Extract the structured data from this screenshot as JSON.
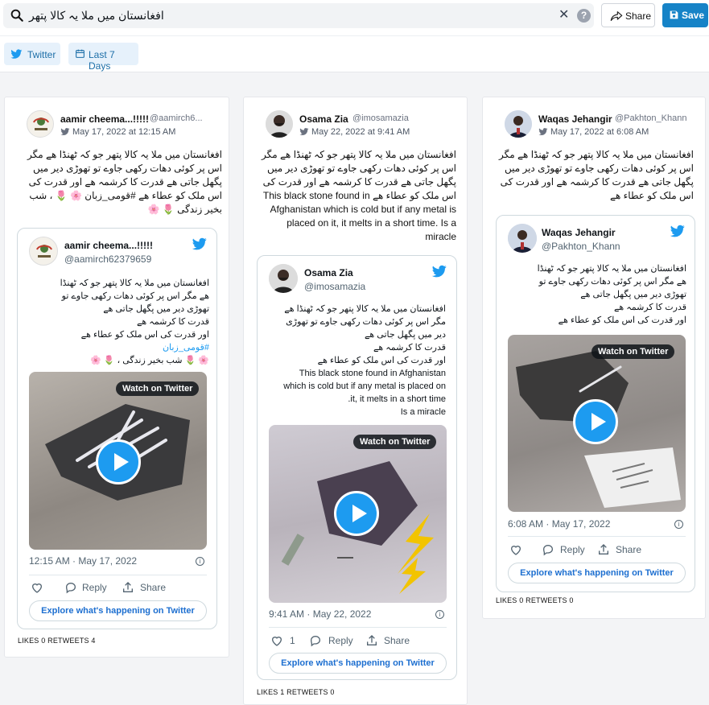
{
  "search": {
    "query": "افغانستان میں ملا یہ کالا پتھر"
  },
  "toolbar": {
    "share_label": "Share",
    "save_label": "Save"
  },
  "filters": {
    "source_label": "Twitter",
    "range_label": "Last 7 Days"
  },
  "colors": {
    "accent": "#1683c7",
    "twitter_blue": "#1d9bf0",
    "chip_bg": "#e6f1fb"
  },
  "cards": [
    {
      "name": "aamir cheema...!!!!!",
      "handle": "@aamirch6...",
      "date": "May 17, 2022 at 12:15 AM",
      "text": "افغانستان میں ملا یہ کالا پتھر جو کہ ٹھنڈا ھے مگر اس پر کوئی دھات رکھی جاوے تو تھوڑی دیر میں پگھل جاتی ھے قدرت کا کرشمہ ھے اور قدرت کی اس ملک کو عطاء ھے #قومی_زبان 🌸 🌷 ، شب بخیر زندگی 🌷 🌸",
      "embed": {
        "name": "aamir cheema...!!!!!",
        "handle": "@aamirch62379659",
        "lines": [
          "افغانستان میں ملا یہ کالا پتھر جو کہ ٹھنڈا",
          "ھے مگر اس پر کوئی دھات رکھی جاوے تو",
          "تھوڑی دیر میں پگھل جاتی ھے",
          "قدرت کا کرشمہ ھے",
          "اور قدرت کی اس ملک کو عطاء ھے"
        ],
        "hashtag": "#قومی_زبان",
        "tail": "🌸 🌷 شب بخیر زندگی ، 🌷 🌸",
        "watch_label": "Watch on Twitter",
        "time": "12:15 AM · May 17, 2022",
        "like_count": "",
        "reply_label": "Reply",
        "share_label": "Share",
        "explore_label": "Explore what's happening on Twitter"
      },
      "stats": "LIKES 0   RETWEETS 4"
    },
    {
      "name": "Osama Zia",
      "handle": "@imosamazia",
      "date": "May 22, 2022 at 9:41 AM",
      "text": "افغانستان میں ملا یہ کالا پتھر جو کہ ٹھنڈا ھے مگر اس پر کوئی دھات رکھی جاوے تو تھوڑی دیر میں پگھل جاتی ھے قدرت کا کرشمہ ھے اور قدرت کی اس ملک کو عطاء ھے This black stone found in Afghanistan which is cold but if any metal is placed on it, it melts in a short time. Is a miracle",
      "embed": {
        "name": "Osama Zia",
        "handle": "@imosamazia",
        "lines": [
          "افغانستان میں ملا یہ کالا پتھر جو کہ ٹھنڈا ھے",
          "مگر اس پر کوئی دھات رکھی جاوے تو تھوڑی",
          "دیر میں پگھل جاتی ھے",
          "قدرت کا کرشمہ ھے",
          "اور قدرت کی اس ملک کو عطاء ھے",
          "This black stone found in Afghanistan",
          "which is cold but if any metal is placed on",
          "it, it melts in a short time.",
          "Is a miracle"
        ],
        "watch_label": "Watch on Twitter",
        "time": "9:41 AM · May 22, 2022",
        "like_count": "1",
        "reply_label": "Reply",
        "share_label": "Share",
        "explore_label": "Explore what's happening on Twitter"
      },
      "stats": "LIKES 1   RETWEETS 0"
    },
    {
      "name": "Waqas Jehangir",
      "handle": "@Pakhton_Khann",
      "date": "May 17, 2022 at 6:08 AM",
      "text": "افغانستان میں ملا یہ کالا پتھر جو کہ ٹھنڈا ھے مگر اس پر کوئی دھات رکھی جاوے تو تھوڑی دیر میں پگھل جاتی ھے قدرت کا کرشمہ ھے اور قدرت کی اس ملک کو عطاء ھے",
      "embed": {
        "name": "Waqas Jehangir",
        "handle": "@Pakhton_Khann",
        "lines": [
          "افغانستان میں ملا یہ کالا پتھر جو کہ ٹھنڈا",
          "ھے مگر اس پر کوئی دھات رکھی جاوے تو",
          "تھوڑی دیر میں پگھل جاتی ھے",
          "قدرت کا کرشمہ ھے",
          "اور قدرت کی اس ملک کو عطاء ھے"
        ],
        "watch_label": "Watch on Twitter",
        "time": "6:08 AM · May 17, 2022",
        "like_count": "",
        "reply_label": "Reply",
        "share_label": "Share",
        "explore_label": "Explore what's happening on Twitter"
      },
      "stats": "LIKES 0   RETWEETS 0"
    }
  ]
}
